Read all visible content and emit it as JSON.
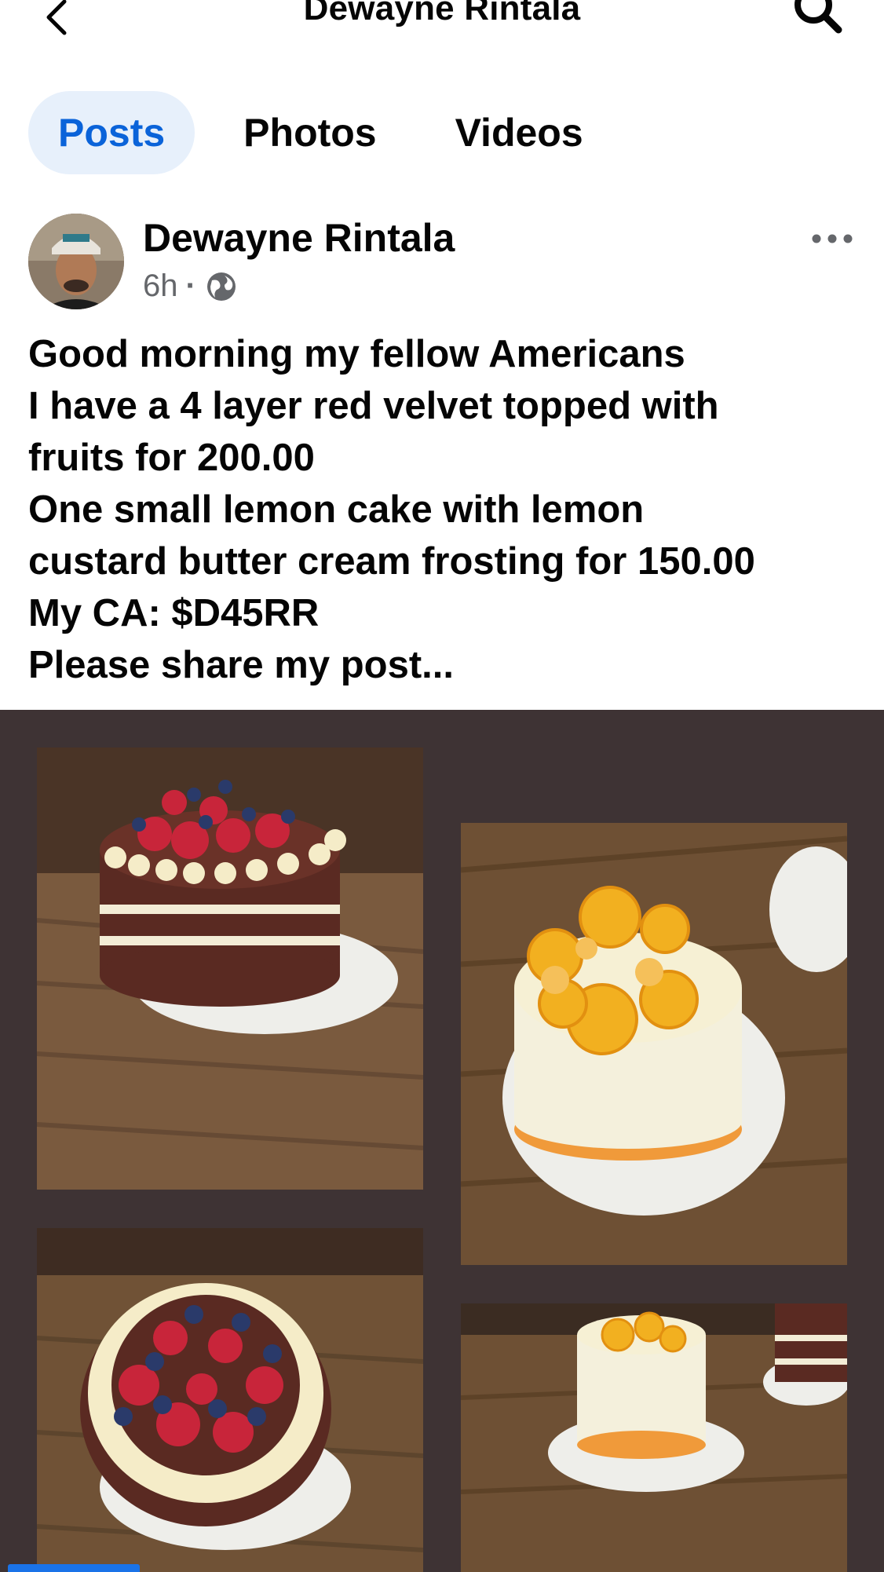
{
  "header": {
    "title": "Dewayne Rintala",
    "back_icon": "chevron-left-icon",
    "search_icon": "search-icon"
  },
  "tabs": [
    {
      "label": "Posts",
      "active": true
    },
    {
      "label": "Photos",
      "active": false
    },
    {
      "label": "Videos",
      "active": false
    }
  ],
  "post": {
    "author": "Dewayne Rintala",
    "time": "6h",
    "separator": "·",
    "privacy_icon": "globe-icon",
    "more_icon": "more-horizontal-icon",
    "lines": [
      "Good morning my fellow Americans",
      "I have a 4 layer red velvet topped with",
      "fruits for 200.00",
      "One small lemon cake with lemon",
      "custard butter cream frosting for 150.00",
      "My CA: $D45RR",
      "Please share my post..."
    ],
    "photos": [
      {
        "subject": "red-velvet-cake-with-berries"
      },
      {
        "subject": "lemon-cake-with-lemon-slices"
      },
      {
        "subject": "red-velvet-cake-top-view"
      },
      {
        "subject": "small-lemon-cake"
      }
    ]
  },
  "colors": {
    "accent": "#0a63d9",
    "tab_active_bg": "#e7f0fb",
    "photo_bg": "#3e3334",
    "meta_text": "#65676b"
  }
}
